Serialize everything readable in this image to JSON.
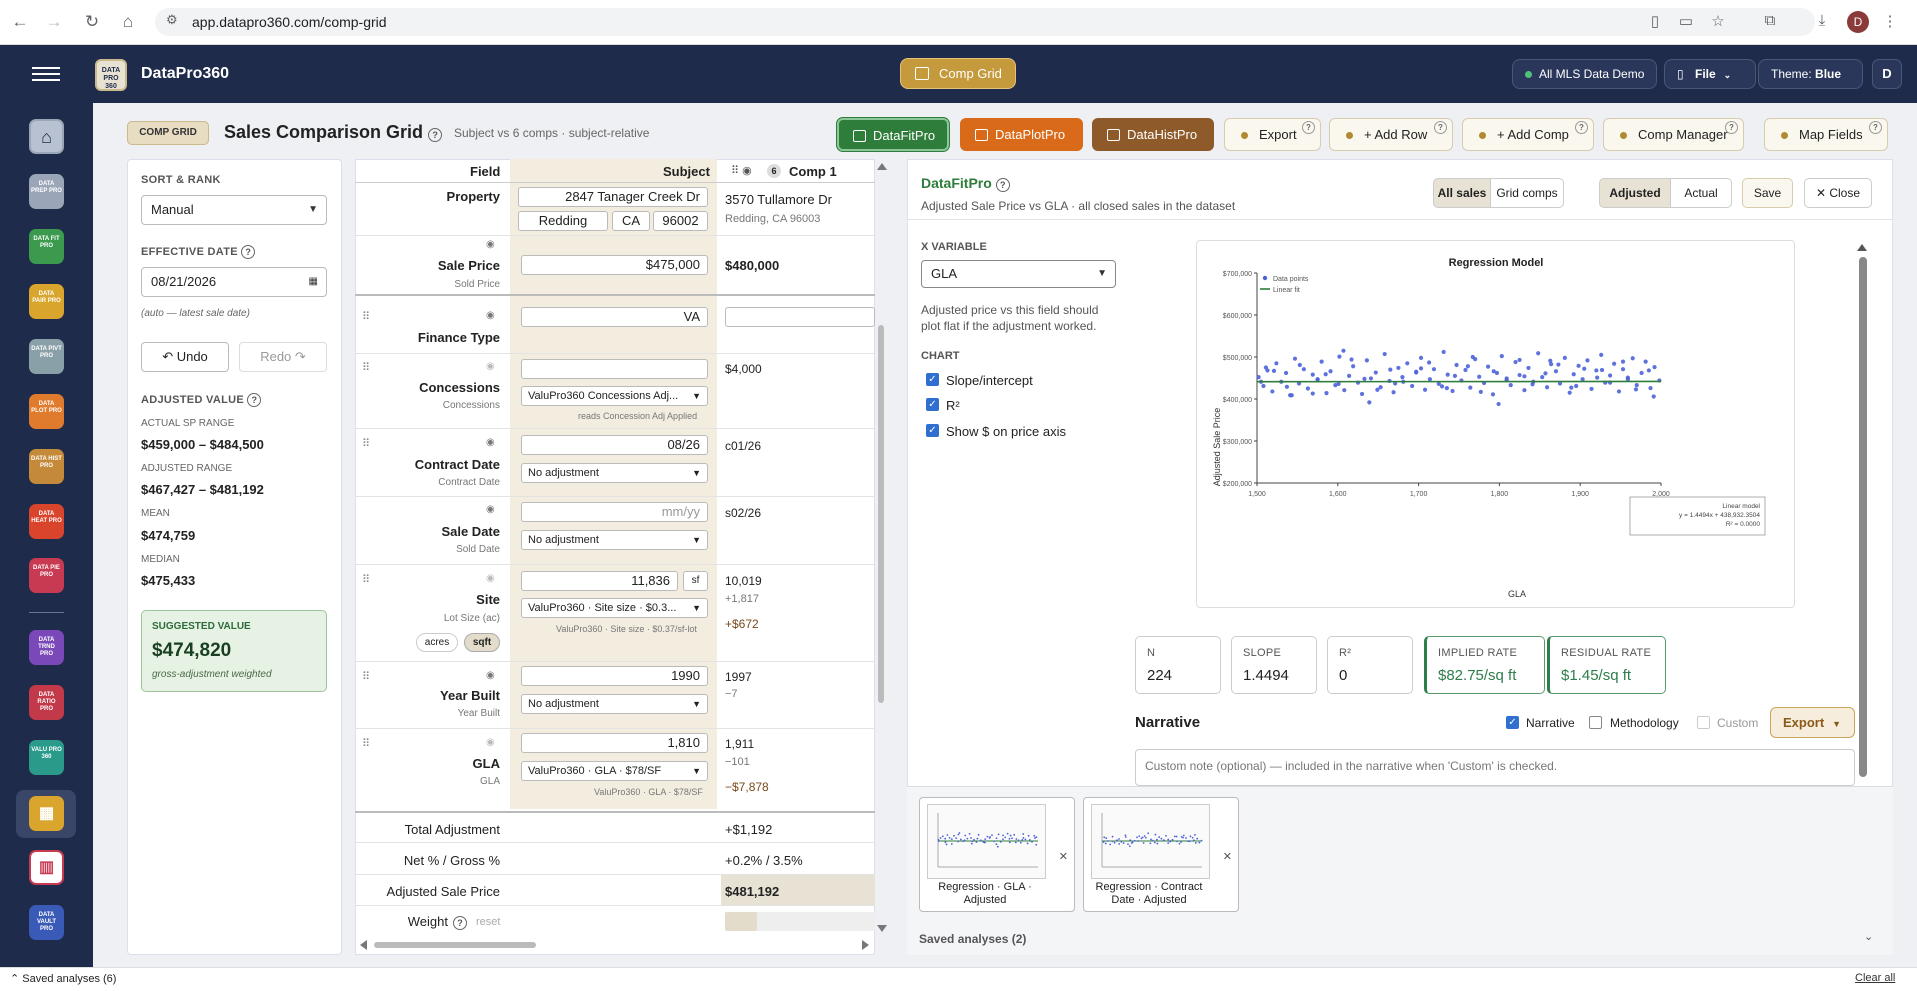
{
  "browser": {
    "url": "app.datapro360.com/comp-grid",
    "profile_initial": "D"
  },
  "header": {
    "brand": "DataPro360",
    "logo_text": "DATA PRO 360",
    "center_button": "Comp Grid",
    "mls": "All MLS Data Demo",
    "file": "File",
    "theme_label": "Theme:",
    "theme_value": "Blue",
    "user_initial": "D"
  },
  "rail": {
    "items": [
      {
        "name": "home",
        "text": "",
        "color": "#9aa5b8"
      },
      {
        "name": "data-prep-pro",
        "text": "DATA PREP PRO",
        "color": "#9aa5b8"
      },
      {
        "name": "data-fit-pro",
        "text": "DATA FIT PRO",
        "color": "#3c9a4e"
      },
      {
        "name": "data-pair-pro",
        "text": "DATA PAIR PRO",
        "color": "#d9a52c"
      },
      {
        "name": "data-pivt-pro",
        "text": "DATA PIVT PRO",
        "color": "#8aa0a8"
      },
      {
        "name": "data-plot-pro",
        "text": "DATA PLOT PRO",
        "color": "#e07a2c"
      },
      {
        "name": "data-hist-pro",
        "text": "DATA HIST PRO",
        "color": "#c48a3a"
      },
      {
        "name": "data-heat-pro",
        "text": "DATA HEAT PRO",
        "color": "#d9442c"
      },
      {
        "name": "data-pie-pro",
        "text": "DATA PIE PRO",
        "color": "#c83a52"
      },
      {
        "name": "data-trnd-pro",
        "text": "DATA TRND PRO",
        "color": "#7a48b8"
      },
      {
        "name": "data-ratio-pro",
        "text": "DATA RATIO PRO",
        "color": "#c23a4a"
      },
      {
        "name": "valu-pro-360",
        "text": "VALU PRO 360",
        "color": "#2a9a8a"
      },
      {
        "name": "comp-grid",
        "text": "",
        "color": "#d9a52c"
      },
      {
        "name": "reports",
        "text": "",
        "color": "#c83a52"
      },
      {
        "name": "data-vault-pro",
        "text": "DATA VAULT PRO",
        "color": "#3a5ab8"
      }
    ]
  },
  "titlebar": {
    "pill": "COMP GRID",
    "title": "Sales Comparison Grid",
    "subtitle": "Subject vs 6 comps · subject-relative",
    "buttons": {
      "fit": "DataFitPro",
      "plot": "DataPlotPro",
      "hist": "DataHistPro",
      "export": "Export",
      "add_row": "+ Add Row",
      "add_comp": "+ Add Comp",
      "comp_manager": "Comp Manager",
      "map_fields": "Map Fields"
    }
  },
  "left": {
    "sort_label": "SORT & RANK",
    "sort_value": "Manual",
    "eff_label": "EFFECTIVE DATE",
    "eff_value": "08/21/2026",
    "eff_note": "(auto — latest sale date)",
    "undo": "↶ Undo",
    "redo": "Redo ↷",
    "adj_label": "ADJUSTED VALUE",
    "actual_lbl": "ACTUAL SP RANGE",
    "actual_val": "$459,000 – $484,500",
    "adjr_lbl": "ADJUSTED RANGE",
    "adjr_val": "$467,427 – $481,192",
    "mean_lbl": "MEAN",
    "mean_val": "$474,759",
    "median_lbl": "MEDIAN",
    "median_val": "$475,433",
    "sugg_lbl": "SUGGESTED VALUE",
    "sugg_val": "$474,820",
    "sugg_note": "gross-adjustment weighted"
  },
  "grid": {
    "col_field": "Field",
    "col_subject": "Subject",
    "comp_count": "6",
    "comp_name": "Comp 1",
    "property": {
      "label": "Property",
      "street": "2847 Tanager Creek Dr",
      "city": "Redding",
      "state": "CA",
      "zip": "96002",
      "comp_street": "3570 Tullamore Dr",
      "comp_city": "Redding, CA 96003"
    },
    "sale_price": {
      "label": "Sale Price",
      "sub": "Sold Price",
      "subject": "$475,000",
      "comp": "$480,000"
    },
    "finance": {
      "label": "Finance Type",
      "subject": "VA"
    },
    "concessions": {
      "label": "Concessions",
      "sub": "Concessions",
      "select": "ValuPro360 Concessions Adj...",
      "note": "reads Concession Adj Applied",
      "comp": "$4,000"
    },
    "contract": {
      "label": "Contract Date",
      "sub": "Contract Date",
      "subject": "08/26",
      "select": "No adjustment",
      "comp": "c01/26"
    },
    "sale_date": {
      "label": "Sale Date",
      "sub": "Sold Date",
      "placeholder": "mm/yy",
      "select": "No adjustment",
      "comp": "s02/26"
    },
    "site": {
      "label": "Site",
      "sub": "Lot Size (ac)",
      "subject": "11,836",
      "unit": "sf",
      "select": "ValuPro360 · Site size · $0.3...",
      "note": "ValuPro360 · Site size · $0.37/sf-lot",
      "acres": "acres",
      "sqft": "sqft",
      "comp": "10,019",
      "comp_diff": "+1,817",
      "comp_adj": "+$672"
    },
    "year": {
      "label": "Year Built",
      "sub": "Year Built",
      "subject": "1990",
      "select": "No adjustment",
      "comp": "1997",
      "comp_diff": "−7"
    },
    "gla": {
      "label": "GLA",
      "sub": "GLA",
      "subject": "1,810",
      "select": "ValuPro360 · GLA · $78/SF",
      "note": "ValuPro360 · GLA · $78/SF",
      "comp": "1,911",
      "comp_diff": "−101",
      "comp_adj": "−$7,878"
    },
    "totals": {
      "total_lbl": "Total Adjustment",
      "total_val": "+$1,192",
      "net_lbl": "Net % / Gross %",
      "net_val": "+0.2% / 3.5%",
      "asp_lbl": "Adjusted Sale Price",
      "asp_val": "$481,192",
      "weight_lbl": "Weight",
      "reset": "reset"
    }
  },
  "fit": {
    "title": "DataFitPro",
    "desc": "Adjusted Sale Price vs GLA · all closed sales in the dataset",
    "all_sales": "All sales",
    "grid_comps": "Grid comps",
    "adjusted": "Adjusted",
    "actual": "Actual",
    "save": "Save",
    "close": "✕ Close",
    "xvar_label": "X VARIABLE",
    "xvar": "GLA",
    "xvar_note": "Adjusted price vs this field should plot flat if the adjustment worked.",
    "chart_label": "CHART",
    "opt1": "Slope/intercept",
    "opt2": "R²",
    "opt3": "Show $ on price axis",
    "stats": {
      "n_l": "N",
      "n_v": "224",
      "slope_l": "SLOPE",
      "slope_v": "1.4494",
      "r2_l": "R²",
      "r2_v": "0",
      "implied_l": "IMPLIED RATE",
      "implied_v": "$82.75/sq ft",
      "resid_l": "RESIDUAL RATE",
      "resid_v": "$1.45/sq ft"
    },
    "narrative": "Narrative",
    "n_opt": "Narrative",
    "meth": "Methodology",
    "custom": "Custom",
    "export": "Export",
    "note_placeholder": "Custom note (optional) — included in the narrative when 'Custom' is checked.",
    "thumb1": "Regression · GLA · Adjusted",
    "thumb2": "Regression · Contract Date · Adjusted",
    "saved": "Saved analyses (2)"
  },
  "statusbar": {
    "saved": "Saved analyses (6)",
    "clear": "Clear all"
  },
  "chart_data": {
    "type": "scatter",
    "title": "Regression Model",
    "xlabel": "GLA",
    "ylabel": "Adjusted Sale Price",
    "xlim": [
      1500,
      2000
    ],
    "ylim": [
      200000,
      700000
    ],
    "xticks": [
      "1,500",
      "1,600",
      "1,700",
      "1,800",
      "1,900",
      "2,000"
    ],
    "yticks": [
      "$200,000",
      "$300,000",
      "$400,000",
      "$500,000",
      "$600,000",
      "$700,000"
    ],
    "legend": [
      "Data points",
      "Linear fit"
    ],
    "legend_position": "top-left",
    "fit": {
      "slope": 1.4494,
      "intercept": 438932.3504
    },
    "model_box": [
      "Linear model",
      "y = 1.4494x + 438,932.3504",
      "R² = 0.0000"
    ],
    "series": [
      {
        "x": [
          1502,
          1508,
          1513,
          1519,
          1524,
          1530,
          1536,
          1541,
          1547,
          1552,
          1558,
          1563,
          1569,
          1575,
          1580,
          1586,
          1591,
          1597,
          1602,
          1608,
          1614,
          1619,
          1625,
          1630,
          1636,
          1641,
          1647,
          1653,
          1658,
          1664,
          1669,
          1675,
          1680,
          1686,
          1692,
          1697,
          1703,
          1708,
          1714,
          1719,
          1725,
          1731,
          1736,
          1742,
          1747,
          1753,
          1758,
          1764,
          1770,
          1775,
          1781,
          1786,
          1792,
          1797,
          1803,
          1809,
          1814,
          1820,
          1825,
          1831,
          1836,
          1842,
          1848,
          1853,
          1859,
          1864,
          1870,
          1875,
          1881,
          1887,
          1892,
          1898,
          1903,
          1909,
          1914,
          1920,
          1926,
          1931,
          1937,
          1942,
          1948,
          1953,
          1959,
          1965,
          1970,
          1976,
          1981,
          1987,
          1992,
          1998,
          1505,
          1521,
          1537,
          1553,
          1569,
          1585,
          1601,
          1617,
          1633,
          1649,
          1665,
          1681,
          1697,
          1713,
          1729,
          1745,
          1761,
          1777,
          1793,
          1809,
          1825,
          1841,
          1857,
          1873,
          1889,
          1905,
          1921,
          1937,
          1953,
          1969,
          1985,
          1511,
          1543,
          1575,
          1607,
          1639,
          1671,
          1703,
          1735,
          1767,
          1799,
          1831,
          1863,
          1895,
          1927,
          1959,
          1991
        ],
        "y": [
          452000,
          431000,
          468000,
          418000,
          485000,
          441000,
          462000,
          409000,
          496000,
          437000,
          471000,
          425000,
          458000,
          447000,
          489000,
          414000,
          466000,
          433000,
          501000,
          421000,
          455000,
          478000,
          439000,
          412000,
          492000,
          449000,
          463000,
          428000,
          507000,
          443000,
          416000,
          474000,
          452000,
          485000,
          431000,
          465000,
          498000,
          422000,
          447000,
          471000,
          436000,
          512000,
          458000,
          419000,
          481000,
          444000,
          469000,
          427000,
          495000,
          453000,
          438000,
          477000,
          411000,
          462000,
          502000,
          445000,
          433000,
          488000,
          457000,
          421000,
          474000,
          441000,
          509000,
          452000,
          428000,
          483000,
          466000,
          437000,
          498000,
          415000,
          459000,
          479000,
          447000,
          492000,
          424000,
          468000,
          505000,
          439000,
          456000,
          484000,
          418000,
          471000,
          451000,
          497000,
          433000,
          462000,
          489000,
          426000,
          476000,
          444000,
          441000,
          467000,
          429000,
          481000,
          413000,
          459000,
          436000,
          494000,
          448000,
          422000,
          470000,
          441000,
          463000,
          487000,
          430000,
          455000,
          478000,
          417000,
          466000,
          449000,
          493000,
          435000,
          461000,
          482000,
          427000,
          472000,
          451000,
          439000,
          489000,
          423000,
          468000,
          475000,
          409000,
          446000,
          515000,
          392000,
          437000,
          473000,
          426000,
          500000,
          388000,
          454000,
          491000,
          431000,
          469000,
          447000,
          406000
        ]
      }
    ]
  }
}
